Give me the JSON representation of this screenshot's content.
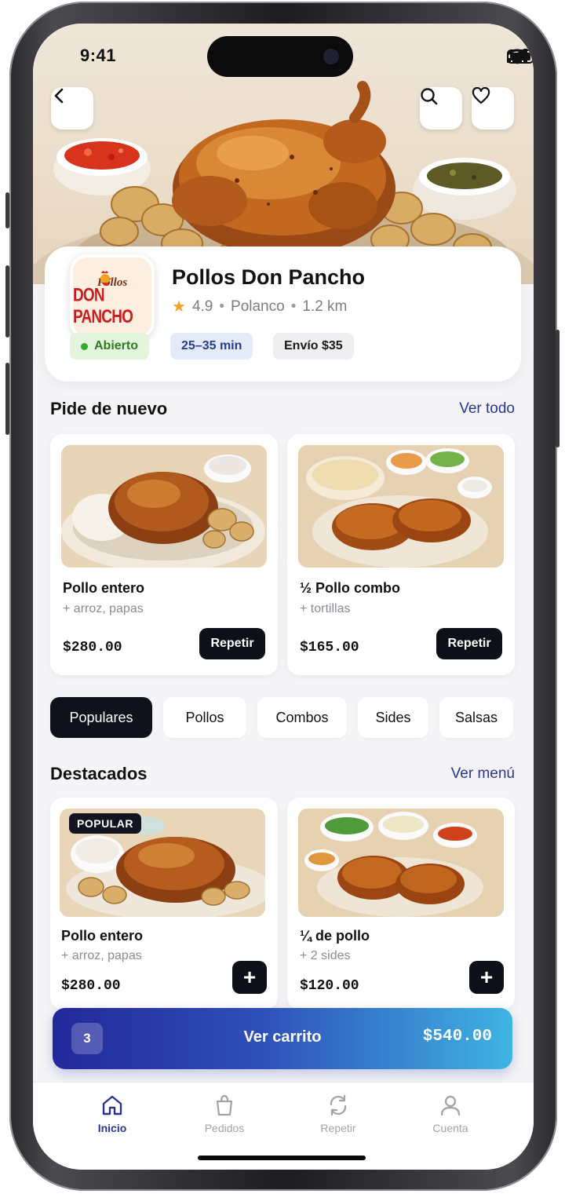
{
  "status_bar": {
    "time": "9:41"
  },
  "restaurant": {
    "logo_top": "Pollos",
    "logo_main": "DON PANCHO",
    "name": "Pollos Don Pancho",
    "rating": "4.9",
    "neighborhood": "Polanco",
    "distance": "1.2 km",
    "status": "Abierto",
    "eta": "25–35 min",
    "delivery_fee": "Envío $35"
  },
  "reorder": {
    "title": "Pide de nuevo",
    "link": "Ver todo",
    "items": [
      {
        "name": "Pollo entero",
        "sub": "+ arroz, papas",
        "price": "$280.00",
        "button": "Repetir"
      },
      {
        "name": "½ Pollo combo",
        "sub": "+ tortillas",
        "price": "$165.00",
        "button": "Repetir"
      }
    ]
  },
  "categories": [
    "Populares",
    "Pollos",
    "Combos",
    "Sides",
    "Salsas"
  ],
  "featured": {
    "title": "Destacados",
    "link": "Ver menú",
    "items": [
      {
        "badge": "POPULAR",
        "name": "Pollo entero",
        "sub": "+ arroz, papas",
        "price": "$280.00"
      },
      {
        "name": "¼ de pollo",
        "sub": "+ 2 sides",
        "price": "$120.00"
      }
    ]
  },
  "cart": {
    "count": "3",
    "label": "Ver carrito",
    "total": "$540.00"
  },
  "nav": [
    {
      "label": "Inicio",
      "icon": "home-icon"
    },
    {
      "label": "Pedidos",
      "icon": "bag-icon"
    },
    {
      "label": "Repetir",
      "icon": "repeat-icon"
    },
    {
      "label": "Cuenta",
      "icon": "user-icon"
    }
  ],
  "colors": {
    "accent": "#2a3593",
    "dark_button": "#0d1019",
    "open_green": "#36a92a",
    "star": "#f2a223"
  }
}
